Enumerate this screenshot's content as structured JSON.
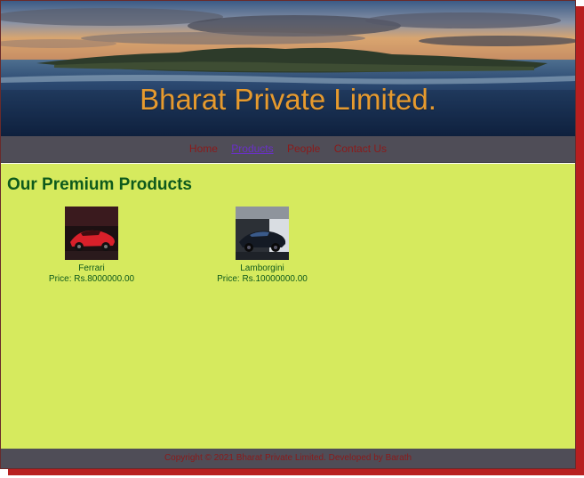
{
  "banner": {
    "title": "Bharat Private Limited."
  },
  "nav": {
    "items": [
      {
        "label": "Home",
        "active": false
      },
      {
        "label": "Products",
        "active": true
      },
      {
        "label": "People",
        "active": false
      },
      {
        "label": "Contact Us",
        "active": false
      }
    ]
  },
  "main": {
    "heading": "Our Premium Products",
    "products": [
      {
        "name": "Ferrari",
        "price": "Price: Rs.8000000.00",
        "image": "red-sports-car"
      },
      {
        "name": "Lamborgini",
        "price": "Price: Rs.10000000.00",
        "image": "dark-sports-car"
      }
    ]
  },
  "footer": {
    "text": "Copyright © 2021 Bharat Private Limited. Developed by Barath"
  },
  "colors": {
    "content_background": "#d6ea5e",
    "nav_background": "#4f4d57",
    "nav_link": "#8b1a1a",
    "active_link": "#6a2fc9",
    "heading": "#0e5a1c",
    "title": "#e69a2e",
    "shadow": "#b81f1f"
  }
}
